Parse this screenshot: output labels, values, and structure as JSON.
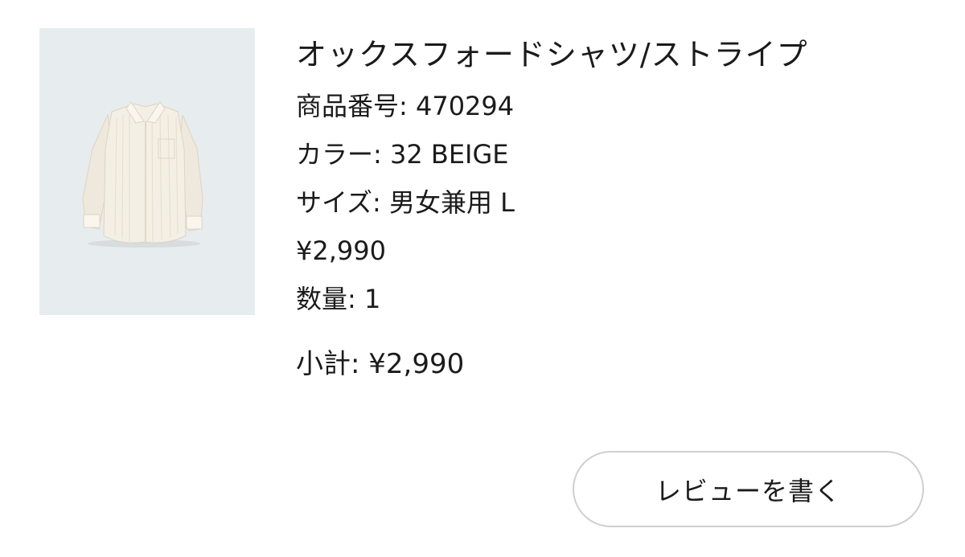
{
  "product": {
    "image_alt": "shirt-image",
    "title": "オックスフォードシャツ/ストライプ",
    "sku_label": "商品番号",
    "sku_value": "470294",
    "color_label": "カラー",
    "color_value": "32 BEIGE",
    "size_label": "サイズ",
    "size_value": "男女兼用 L",
    "price": "¥2,990",
    "qty_label": "数量",
    "qty_value": "1"
  },
  "summary": {
    "subtotal_label": "小計",
    "subtotal_value": "¥2,990"
  },
  "actions": {
    "review_label": "レビューを書く"
  },
  "colors": {
    "image_bg": "#e7ecee",
    "shirt": "#f4efe4",
    "button_border": "#cfcfcf",
    "text": "#1b1b1b"
  }
}
